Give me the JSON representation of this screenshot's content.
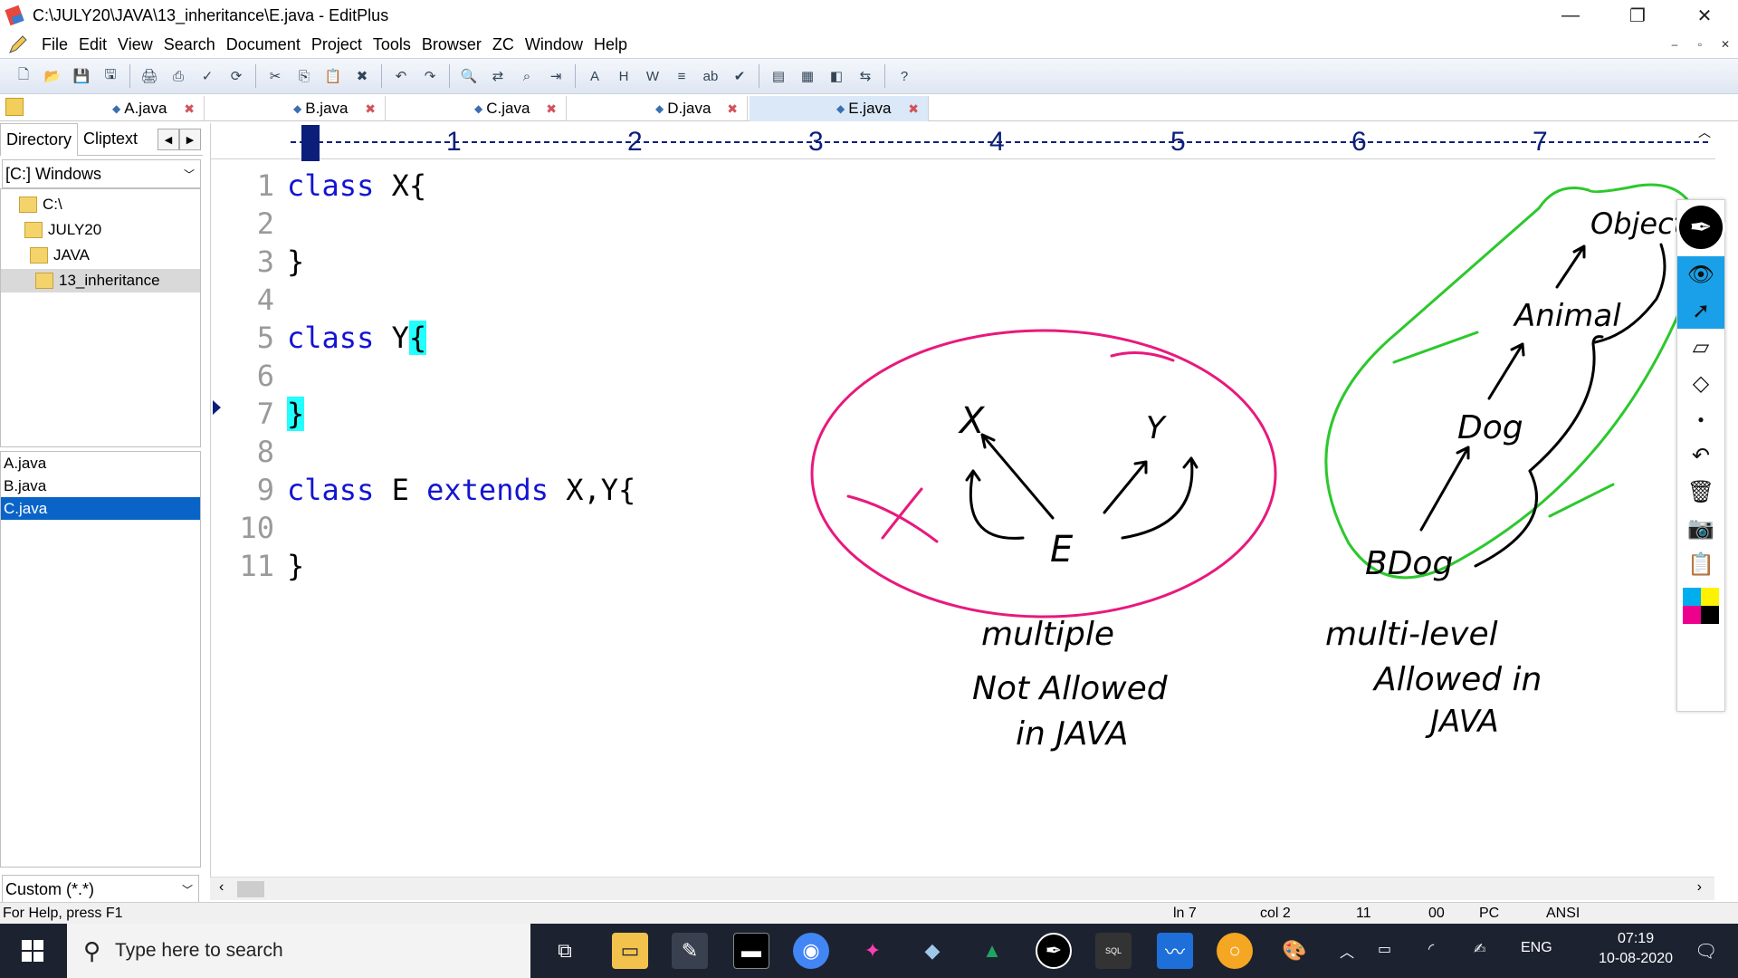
{
  "window": {
    "title": "C:\\JULY20\\JAVA\\13_inheritance\\E.java - EditPlus",
    "minimize": "—",
    "restore": "❐",
    "close": "✕"
  },
  "menu": [
    "File",
    "Edit",
    "View",
    "Search",
    "Document",
    "Project",
    "Tools",
    "Browser",
    "ZC",
    "Window",
    "Help"
  ],
  "mdi_controls": [
    "–",
    "▫",
    "✕"
  ],
  "toolbar_icons": [
    "new-file-icon",
    "open-icon",
    "save-icon",
    "save-all-icon",
    "sep",
    "print-preview-icon",
    "print-icon",
    "spellcheck-icon",
    "reload-icon",
    "sep",
    "cut-icon",
    "copy-icon",
    "paste-icon",
    "delete-icon",
    "sep",
    "undo-icon",
    "redo-icon",
    "sep",
    "find-icon",
    "replace-icon",
    "find-in-files-icon",
    "goto-icon",
    "sep",
    "font-icon",
    "hex-icon",
    "word-wrap-icon",
    "line-numbers-icon",
    "abc-icon",
    "check-icon",
    "sep",
    "view1-icon",
    "view2-icon",
    "browser-icon",
    "compare-icon",
    "sep",
    "help-icon"
  ],
  "tabs": [
    {
      "name": "A.java",
      "active": false
    },
    {
      "name": "B.java",
      "active": false
    },
    {
      "name": "C.java",
      "active": false
    },
    {
      "name": "D.java",
      "active": false
    },
    {
      "name": "E.java",
      "active": true
    }
  ],
  "left": {
    "tab_directory": "Directory",
    "tab_cliptext": "Cliptext",
    "drive": "[C:] Windows",
    "tree": [
      {
        "label": "C:\\",
        "indent": 0,
        "selected": false
      },
      {
        "label": "JULY20",
        "indent": 1,
        "selected": false
      },
      {
        "label": "JAVA",
        "indent": 2,
        "selected": false
      },
      {
        "label": "13_inheritance",
        "indent": 3,
        "selected": true
      }
    ],
    "files": [
      {
        "name": "A.java",
        "selected": false
      },
      {
        "name": "B.java",
        "selected": false
      },
      {
        "name": "C.java",
        "selected": true
      }
    ],
    "filter": "Custom (*.*)"
  },
  "ruler": {
    "numbers": [
      "1",
      "2",
      "3",
      "4",
      "5",
      "6",
      "7"
    ]
  },
  "code": {
    "line_numbers": [
      "1",
      "2",
      "3",
      "4",
      "5",
      "6",
      "7",
      "8",
      "9",
      "10",
      "11"
    ],
    "lines": [
      {
        "kw": "class",
        "rest": " X{"
      },
      {
        "kw": "",
        "rest": ""
      },
      {
        "kw": "",
        "rest": "}"
      },
      {
        "kw": "",
        "rest": ""
      },
      {
        "kw": "class",
        "rest": " Y",
        "hl": "{"
      },
      {
        "kw": "",
        "rest": ""
      },
      {
        "kw": "",
        "rest": "",
        "hl": "}"
      },
      {
        "kw": "",
        "rest": ""
      },
      {
        "kw": "class",
        "rest": " E ",
        "kw2": "extends",
        "rest2": " X,Y{"
      },
      {
        "kw": "",
        "rest": ""
      },
      {
        "kw": "",
        "rest": "}"
      }
    ]
  },
  "ink": {
    "left_diagram": {
      "top_left": "X",
      "top_right": "Y",
      "bottom": "E",
      "caption1": "multiple",
      "caption2": "Not Allowed",
      "caption3": "in JAVA"
    },
    "right_diagram": {
      "n1": "Object",
      "n2": "Animal",
      "n3": "Dog",
      "n4": "BDog",
      "caption1": "multi-level",
      "caption2": "Allowed in",
      "caption3": "JAVA"
    },
    "colors": {
      "pink": "#e8197d",
      "green": "#2cc82c"
    }
  },
  "status": {
    "help": "For Help, press F1",
    "ln": "ln 7",
    "col": "col 2",
    "lines": "11",
    "hex": "00",
    "mode": "PC",
    "encoding": "ANSI"
  },
  "taskbar": {
    "search_placeholder": "Type here to search",
    "lang": "ENG",
    "time": "07:19",
    "date": "10-08-2020"
  }
}
